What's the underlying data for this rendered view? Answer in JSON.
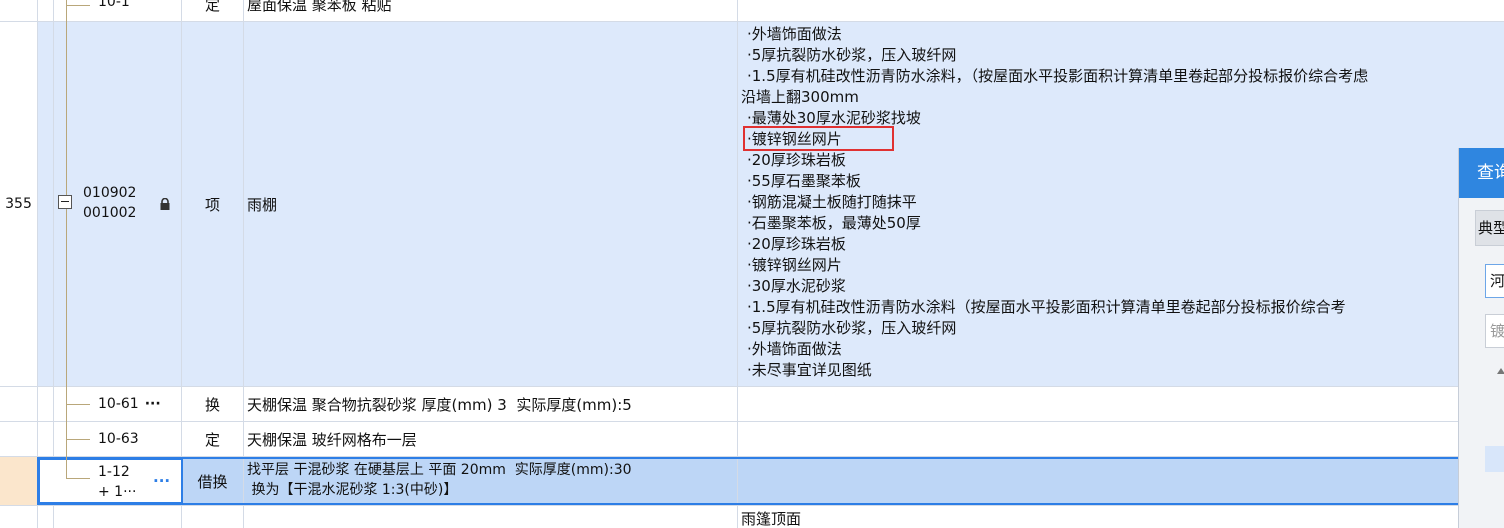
{
  "rows": {
    "r0": {
      "no": "",
      "code": "10-1",
      "type": "定",
      "name": "屋面保温 聚苯板 粘贴",
      "feature": ""
    },
    "main": {
      "no": "355",
      "code_line1": "010902",
      "code_line2": "001002",
      "type": "项",
      "name": "雨棚",
      "features": [
        "·外墙饰面做法",
        "·5厚抗裂防水砂浆，压入玻纤网",
        "·1.5厚有机硅改性沥青防水涂料，（按屋面水平投影面积计算清单里卷起部分投标报价综合考虑",
        "沿墙上翻300mm",
        "·最薄处30厚水泥砂浆找坡",
        "·镀锌钢丝网片",
        "·20厚珍珠岩板",
        "·55厚石墨聚苯板",
        "·钢筋混凝土板随打随抹平",
        "·石墨聚苯板，最薄处50厚",
        "·20厚珍珠岩板",
        "·镀锌钢丝网片",
        "·30厚水泥砂浆",
        "·1.5厚有机硅改性沥青防水涂料（按屋面水平投影面积计算清单里卷起部分投标报价综合考",
        "·5厚抗裂防水砂浆，压入玻纤网",
        "·外墙饰面做法",
        "·未尽事宜详见图纸"
      ]
    },
    "r2": {
      "code": "10-61",
      "more": "···",
      "type": "换",
      "name": "天棚保温 聚合物抗裂砂浆 厚度(mm) 3  实际厚度(mm):5"
    },
    "r3": {
      "code": "10-63",
      "type": "定",
      "name": "天棚保温 玻纤网格布一层"
    },
    "r4": {
      "code_line1": "1-12",
      "code_line2": "+ 1···",
      "more": "···",
      "type": "借换",
      "name_line1": "找平层 干混砂浆 在硬基层上 平面 20mm  实际厚度(mm):30",
      "name_line2": " 换为【干混水泥砂浆 1:3(中砂)】"
    },
    "r5": {
      "feature": "雨篷顶面"
    }
  },
  "panel": {
    "title": "查询",
    "tab": "典型",
    "input1": "河",
    "input2": "镀"
  },
  "colors": {
    "selection_border": "#2d7ee6",
    "highlight_box": "#e03131",
    "row_blue": "#dde9fb",
    "panel_header": "#2f86e0"
  }
}
